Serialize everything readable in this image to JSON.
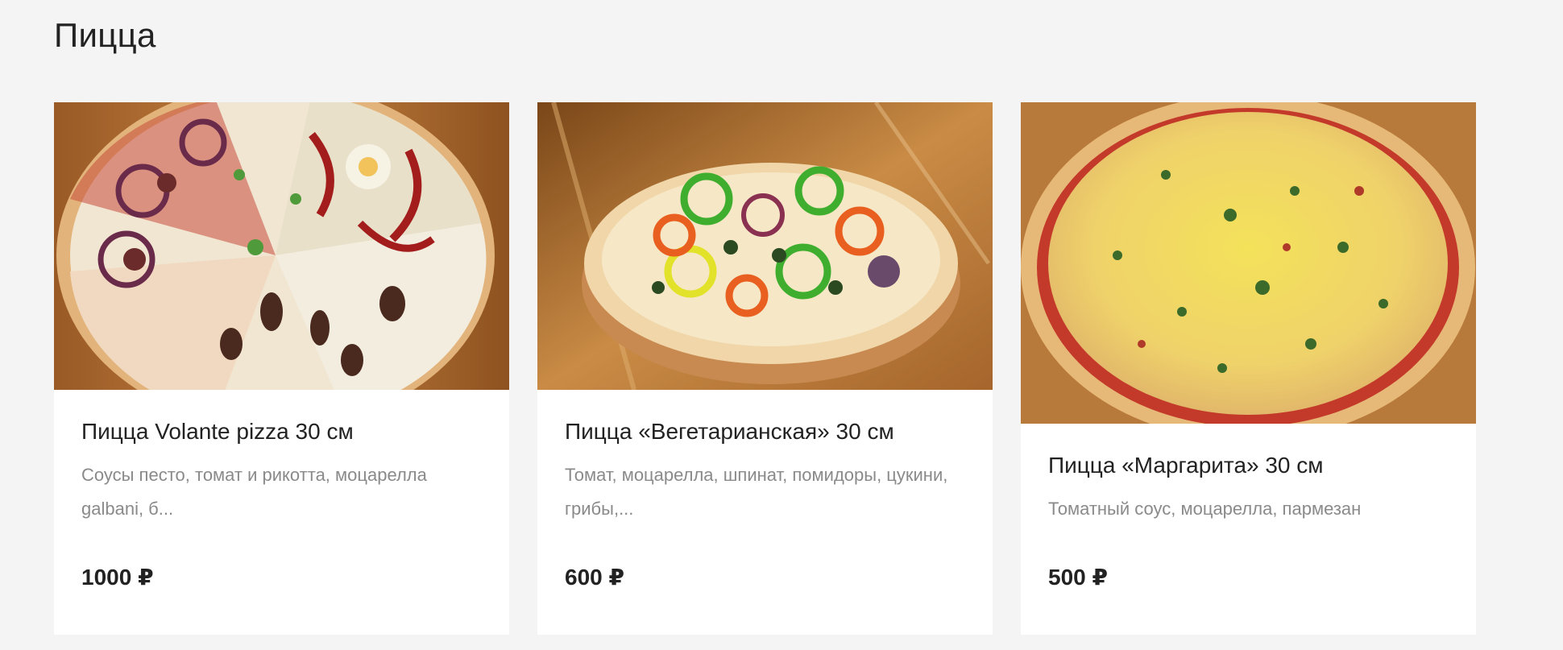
{
  "section": {
    "title": "Пицца"
  },
  "products": [
    {
      "name": "Пицца Volante pizza 30 см",
      "description": "Соусы песто, томат и рикотта, моцарелла galbani, б...",
      "price": "1000 ₽",
      "image_icon": "pizza-volante-photo"
    },
    {
      "name": "Пицца «Вегетарианская» 30 см",
      "description": "Томат, моцарелла, шпинат, помидоры, цукини, грибы,...",
      "price": "600 ₽",
      "image_icon": "pizza-vegetarian-photo"
    },
    {
      "name": "Пицца «Маргарита» 30 см",
      "description": "Томатный соус, моцарелла, пармезан",
      "price": "500 ₽",
      "image_icon": "pizza-margherita-photo"
    }
  ],
  "colors": {
    "background": "#f4f4f4",
    "card": "#ffffff",
    "text": "#222222",
    "muted": "#8a8a8a"
  }
}
